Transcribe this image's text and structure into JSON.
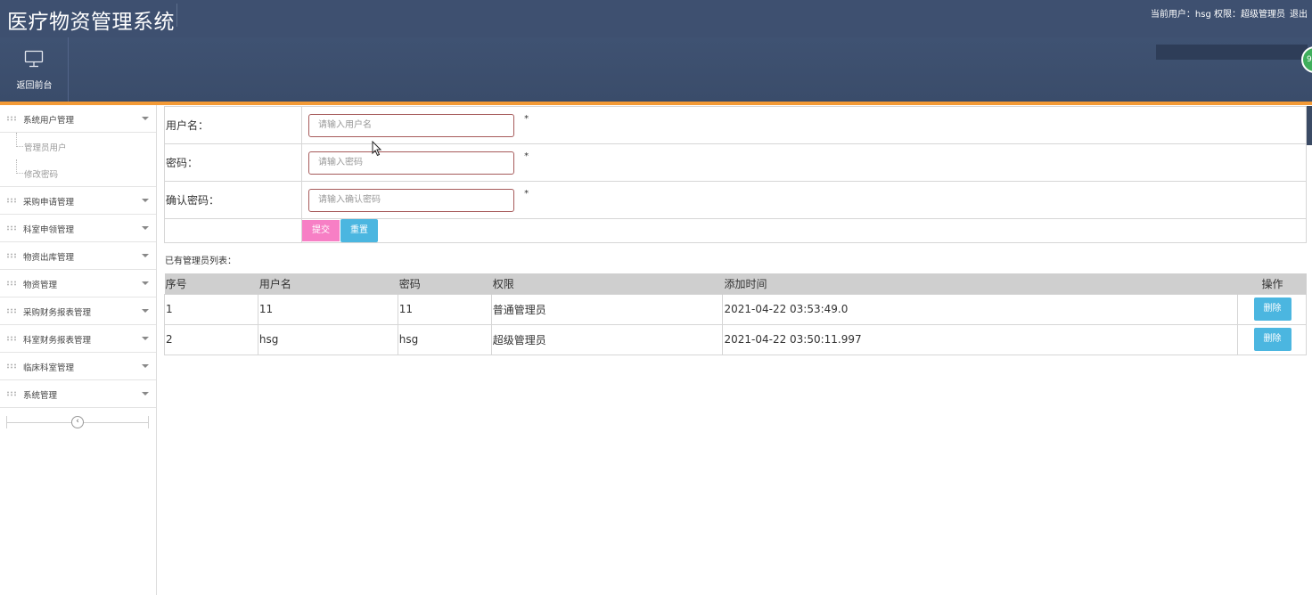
{
  "header": {
    "app_title": "医疗物资管理系统",
    "user_info": "当前用户：hsg  权限：超级管理员",
    "logout": "退出"
  },
  "toolbar": {
    "home_label": "返回前台",
    "home_icon": "monitor-icon"
  },
  "sidebar": {
    "items": [
      {
        "label": "系统用户管理",
        "expanded": true,
        "children": [
          "管理员用户",
          "修改密码"
        ]
      },
      {
        "label": "采购申请管理"
      },
      {
        "label": "科室申领管理"
      },
      {
        "label": "物资出库管理"
      },
      {
        "label": "物资管理"
      },
      {
        "label": "采购财务报表管理"
      },
      {
        "label": "科室财务报表管理"
      },
      {
        "label": "临床科室管理"
      },
      {
        "label": "系统管理"
      }
    ]
  },
  "form": {
    "username_label": "用户名：",
    "username_placeholder": "请输入用户名",
    "password_label": "密码：",
    "password_placeholder": "请输入密码",
    "confirm_label": "确认密码：",
    "confirm_placeholder": "请输入确认密码",
    "required_mark": "*",
    "submit_label": "提交",
    "reset_label": "重置"
  },
  "list": {
    "caption": "已有管理员列表：",
    "columns": [
      "序号",
      "用户名",
      "密码",
      "权限",
      "添加时间",
      "操作"
    ],
    "rows": [
      {
        "index": "1",
        "username": "11",
        "password": "11",
        "role": "普通管理员",
        "created": "2021-04-22 03:53:49.0",
        "action": "删除"
      },
      {
        "index": "2",
        "username": "hsg",
        "password": "hsg",
        "role": "超级管理员",
        "created": "2021-04-22 03:50:11.997",
        "action": "删除"
      }
    ]
  },
  "colors": {
    "header_bg": "#3e5070",
    "accent_line": "#f39a36",
    "submit_btn": "#f77fc5",
    "primary_btn": "#4bb6e0"
  }
}
